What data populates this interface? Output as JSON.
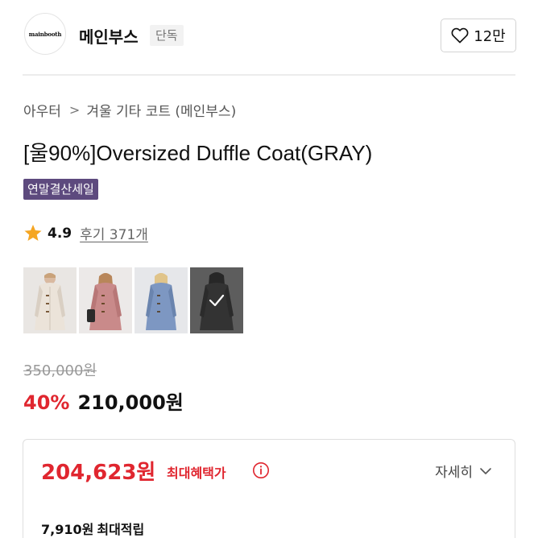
{
  "store": {
    "logo_text": "mainbooth",
    "name": "메인부스",
    "badge": "단독",
    "like_count": "12만"
  },
  "breadcrumb": {
    "category": "아우터",
    "separator": ">",
    "subcategory": "겨울 기타 코트 (메인부스)"
  },
  "product": {
    "title": "[울90%]Oversized Duffle Coat(GRAY)",
    "sale_badge": "연말결산세일",
    "rating": "4.9",
    "reviews": "후기 371개",
    "thumbnails": [
      {
        "color": "ivory"
      },
      {
        "color": "pink"
      },
      {
        "color": "blue"
      },
      {
        "color": "gray",
        "selected": true
      }
    ]
  },
  "price": {
    "original": "350,000원",
    "discount_rate": "40%",
    "sale": "210,000원"
  },
  "benefit": {
    "max_benefit_price": "204,623원",
    "max_benefit_label": "최대혜택가",
    "detail_label": "자세히",
    "points_amount": "7,910원",
    "points_label": "최대적립"
  },
  "colors": {
    "accent_red": "#e0262f",
    "badge_purple": "#5d4a7e",
    "star": "#f5a623"
  }
}
